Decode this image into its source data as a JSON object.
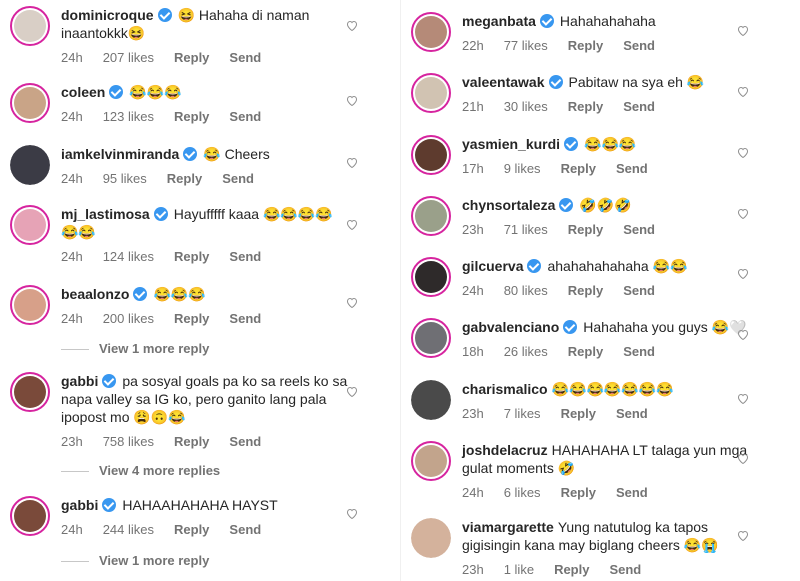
{
  "left": {
    "comments": [
      {
        "username": "dominicroque",
        "text": "😆 Hahaha di naman inaantokkk😆",
        "time": "24h",
        "likes": "207 likes",
        "reply": "Reply",
        "send": "Send",
        "avatar_color": "#d9cfc6"
      },
      {
        "username": "coleen",
        "text": "😂😂😂",
        "time": "24h",
        "likes": "123 likes",
        "reply": "Reply",
        "send": "Send",
        "avatar_color": "#c9a487"
      },
      {
        "username": "iamkelvinmiranda",
        "text": "😂 Cheers",
        "time": "24h",
        "likes": "95 likes",
        "reply": "Reply",
        "send": "Send",
        "avatar_color": "#3b3b45"
      },
      {
        "username": "mj_lastimosa",
        "text": "Hayufffff kaaa 😂😂😂😂 😂😂",
        "time": "24h",
        "likes": "124 likes",
        "reply": "Reply",
        "send": "Send",
        "avatar_color": "#e6a3b6"
      },
      {
        "username": "beaalonzo",
        "text": "😂😂😂",
        "time": "24h",
        "likes": "200 likes",
        "reply": "Reply",
        "send": "Send",
        "avatar_color": "#d7a089"
      },
      {
        "username": "gabbi",
        "text": "pa sosyal goals pa ko sa reels ko sa napa valley sa IG ko, pero ganito lang pala ipopost mo 😩🙃😂",
        "time": "23h",
        "likes": "758 likes",
        "reply": "Reply",
        "send": "Send",
        "avatar_color": "#7a4a3a"
      },
      {
        "username": "gabbi",
        "text": "HAHAAHAHAHA HAYST",
        "time": "24h",
        "likes": "244 likes",
        "reply": "Reply",
        "send": "Send",
        "avatar_color": "#7a4a3a"
      }
    ],
    "view_more": [
      "View 1 more reply",
      "View 4 more replies",
      "View 1 more reply"
    ]
  },
  "right": {
    "comments": [
      {
        "username": "meganbata",
        "text": "Hahahahahaha",
        "time": "22h",
        "likes": "77 likes",
        "reply": "Reply",
        "send": "Send",
        "avatar_color": "#b58a78"
      },
      {
        "username": "valeentawak",
        "text": "Pabitaw na sya eh 😂",
        "time": "21h",
        "likes": "30 likes",
        "reply": "Reply",
        "send": "Send",
        "avatar_color": "#d1c3b2"
      },
      {
        "username": "yasmien_kurdi",
        "text": "😂😂😂",
        "time": "17h",
        "likes": "9 likes",
        "reply": "Reply",
        "send": "Send",
        "avatar_color": "#5e3b2e"
      },
      {
        "username": "chynsortaleza",
        "text": "🤣🤣🤣",
        "time": "23h",
        "likes": "71 likes",
        "reply": "Reply",
        "send": "Send",
        "avatar_color": "#9aa08a"
      },
      {
        "username": "gilcuerva",
        "text": "ahahahahahaha 😂😂",
        "time": "24h",
        "likes": "80 likes",
        "reply": "Reply",
        "send": "Send",
        "avatar_color": "#2e2a2a"
      },
      {
        "username": "gabvalenciano",
        "text": "Hahahaha you guys 😂🤍",
        "time": "18h",
        "likes": "26 likes",
        "reply": "Reply",
        "send": "Send",
        "avatar_color": "#6f6f74"
      },
      {
        "username": "charismalico",
        "text": "😂😂😂😂😂😂😂",
        "time": "23h",
        "likes": "7 likes",
        "reply": "Reply",
        "send": "Send",
        "avatar_color": "#4a4a4a"
      },
      {
        "username": "joshdelacruz",
        "text": "HAHAHAHA LT talaga yun mga gulat moments 🤣",
        "time": "24h",
        "likes": "6 likes",
        "reply": "Reply",
        "send": "Send",
        "avatar_color": "#c2a48c"
      },
      {
        "username": "viamargarette",
        "text": "Yung natutulog ka tapos gigisingin kana may biglang cheers 😂😭",
        "time": "23h",
        "likes": "1 like",
        "reply": "Reply",
        "send": "Send",
        "avatar_color": "#d4b29c"
      }
    ]
  },
  "icons": {
    "heart": "heart-outline-icon",
    "verified": "verified-badge-icon"
  },
  "colors": {
    "verified": "#3897f0",
    "story_ring": "#d6249f",
    "meta": "#737373"
  }
}
